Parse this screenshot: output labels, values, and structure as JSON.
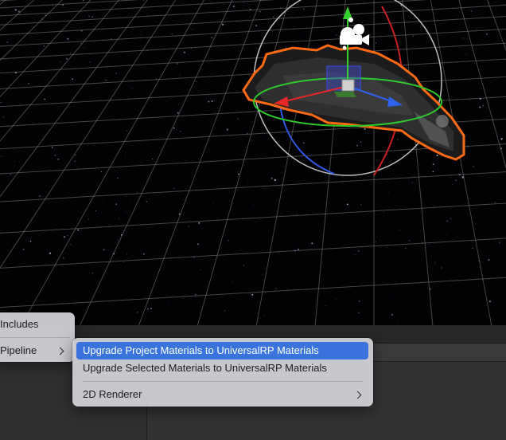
{
  "scene": {
    "accent_selection": "#ff6a13",
    "gizmo_colors": {
      "x": "#e82727",
      "y": "#37d12d",
      "z": "#2f62ea"
    },
    "objects": [
      "starfield-background",
      "grid",
      "spaceship",
      "move-gizmo",
      "rotate-gizmo",
      "camera-icon"
    ]
  },
  "parent_menu": {
    "items": [
      {
        "label": "Includes",
        "has_submenu": false
      },
      {
        "label": "Pipeline",
        "has_submenu": true
      }
    ]
  },
  "submenu": {
    "items": [
      {
        "label": "Upgrade Project Materials to UniversalRP Materials",
        "highlighted": true
      },
      {
        "label": "Upgrade Selected Materials to UniversalRP Materials",
        "highlighted": false
      },
      {
        "label": "2D Renderer",
        "has_submenu": true
      }
    ],
    "highlight_color": "#3a73dd"
  }
}
